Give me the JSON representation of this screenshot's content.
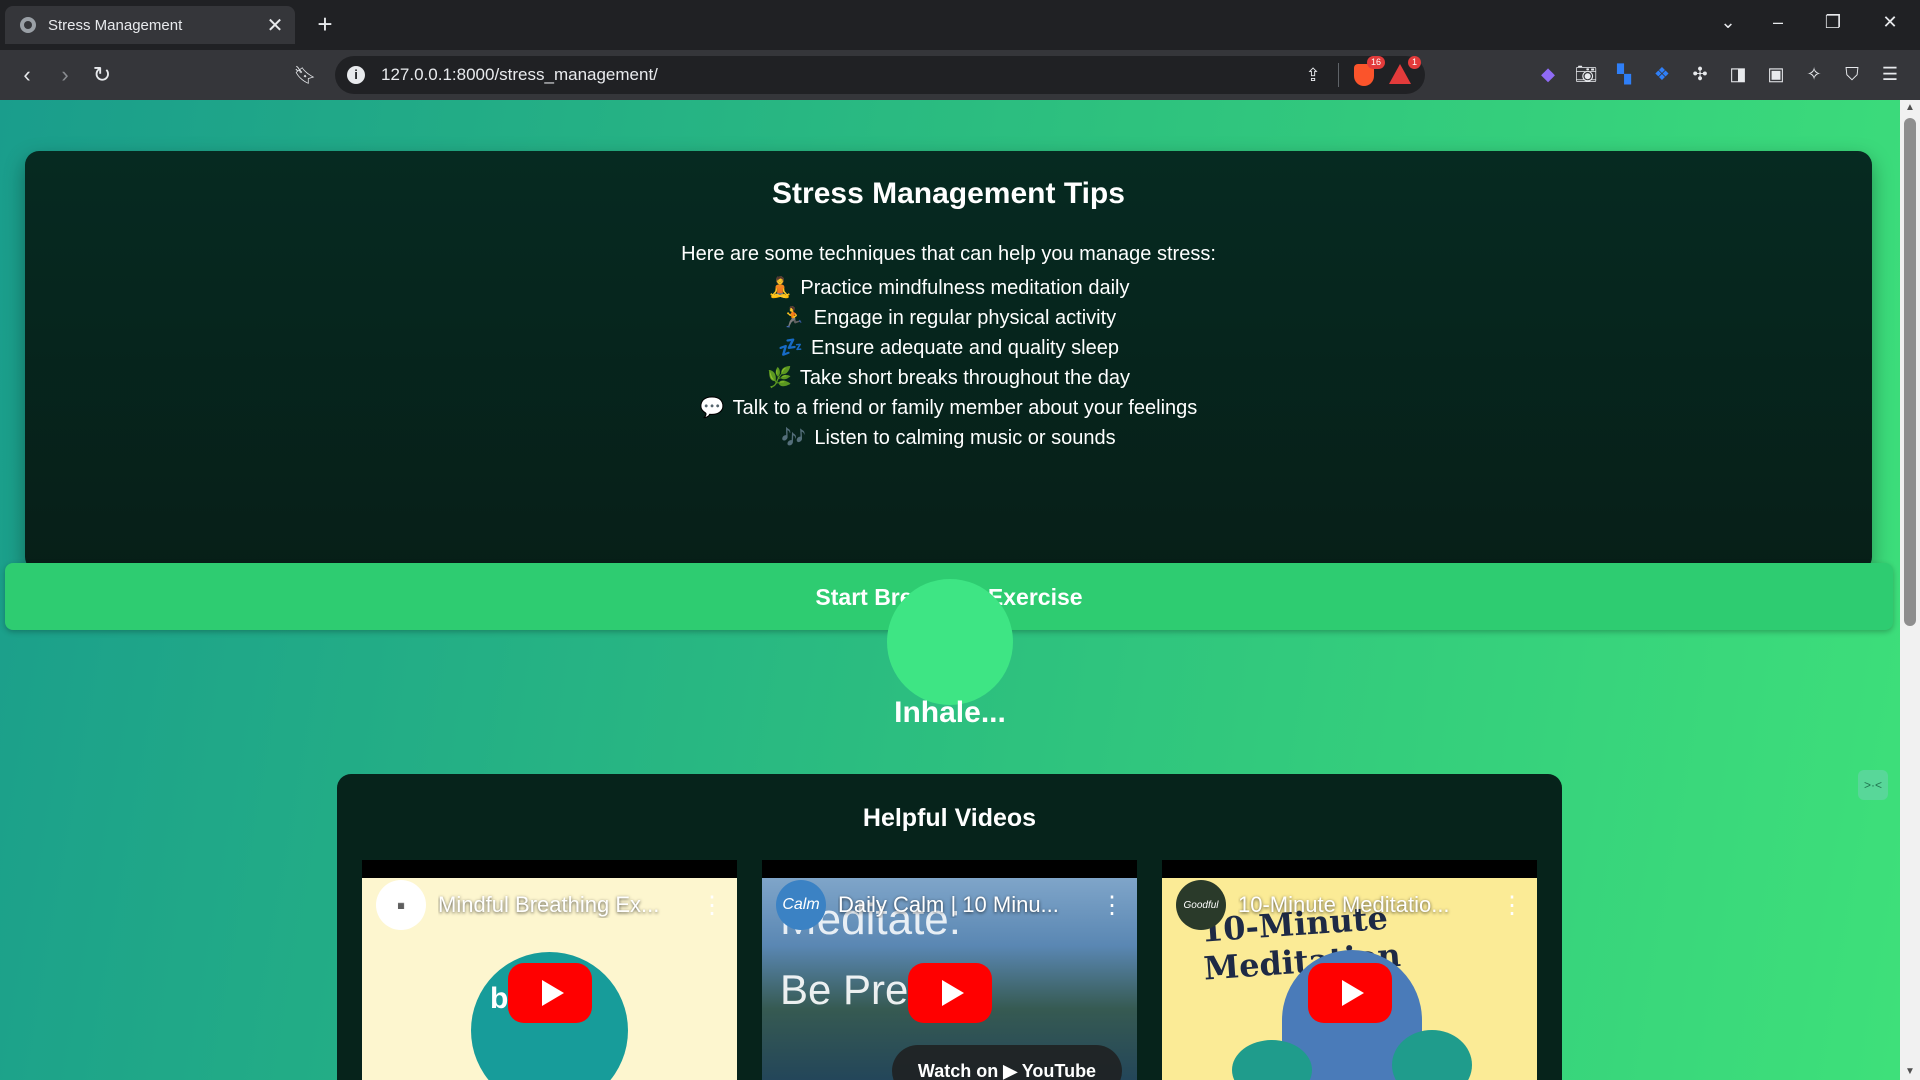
{
  "browser": {
    "tab_title": "Stress Management",
    "tab_close": "✕",
    "new_tab": "+",
    "url": "127.0.0.1:8000/stress_management/",
    "brave_shield_count": "16",
    "rewards_count": "1"
  },
  "tips": {
    "title": "Stress Management Tips",
    "intro": "Here are some techniques that can help you manage stress:",
    "items": [
      {
        "emoji": "🧘",
        "text": "Practice mindfulness meditation daily"
      },
      {
        "emoji": "🏃",
        "text": "Engage in regular physical activity"
      },
      {
        "emoji": "💤",
        "text": "Ensure adequate and quality sleep"
      },
      {
        "emoji": "🌿",
        "text": "Take short breaks throughout the day"
      },
      {
        "emoji": "💬",
        "text": "Talk to a friend or family member about your feelings"
      },
      {
        "emoji": "🎶",
        "text": "Listen to calming music or sounds"
      }
    ],
    "button_label": "Start Breathing Exercise"
  },
  "breathing": {
    "status": "Inhale..."
  },
  "videos": {
    "title": "Helpful Videos",
    "items": [
      {
        "title": "Mindful Breathing Ex...",
        "thumb_text": "b   e"
      },
      {
        "title": "Daily Calm | 10 Minu...",
        "channel_text": "Calm",
        "thumb_text_1": "Meditate:",
        "thumb_text_2": "Be Pre",
        "watch_label": "Watch on ▶ YouTube"
      },
      {
        "title": "10-Minute Meditatio...",
        "channel_text": "Goodful",
        "thumb_text": "10-Minute Meditation"
      }
    ]
  },
  "colors": {
    "accent_green": "#2ecc71",
    "card_bg": "#062a21",
    "youtube_red": "#ff0000"
  }
}
